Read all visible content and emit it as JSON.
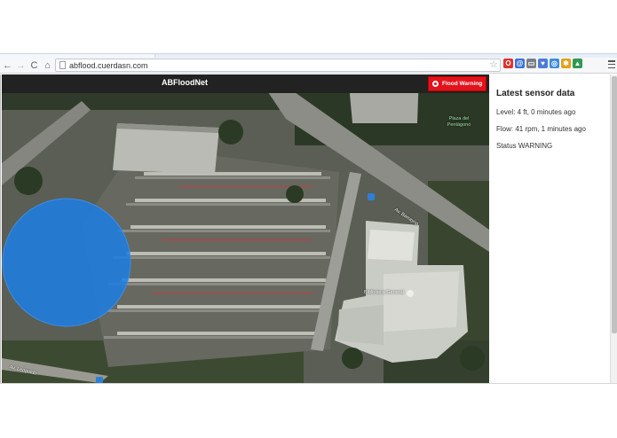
{
  "browser": {
    "url": "abflood.cuerdasn.com",
    "back_icon": "arrow-left-icon",
    "forward_icon": "arrow-right-icon",
    "reload_icon": "reload-icon",
    "home_icon": "home-icon",
    "bookmark_icon": "star-icon",
    "extensions": [
      {
        "name": "opera-extension-icon",
        "color": "#e1322b",
        "glyph": "O"
      },
      {
        "name": "mail-extension-icon",
        "color": "#3b73d6",
        "glyph": "@"
      },
      {
        "name": "cast-extension-icon",
        "color": "#7b8088",
        "glyph": "▭"
      },
      {
        "name": "pocket-extension-icon",
        "color": "#4d7bd8",
        "glyph": "♥"
      },
      {
        "name": "sync-extension-icon",
        "color": "#3a8be0",
        "glyph": "◎"
      },
      {
        "name": "puzzle-extension-icon",
        "color": "#e0a21a",
        "glyph": "✱"
      },
      {
        "name": "drive-extension-icon",
        "color": "#2f9a54",
        "glyph": "▲"
      }
    ]
  },
  "app": {
    "brand": "ABFloodNet",
    "warning_button": "Flood Warning",
    "warning_color": "#e3131b",
    "flood_circle_color": "#1e7de0"
  },
  "map": {
    "labels": {
      "street_1": "Av. Leopoldo",
      "street_2": "Av. Barrayno",
      "park": "Plaza del Pentágono",
      "library": "Biblioteca General"
    }
  },
  "panel": {
    "title": "Latest sensor data",
    "level": "Level: 4 ft, 0 minutes ago",
    "flow": "Flow: 41 rpm, 1 minutes ago",
    "status": "Status WARNING"
  }
}
